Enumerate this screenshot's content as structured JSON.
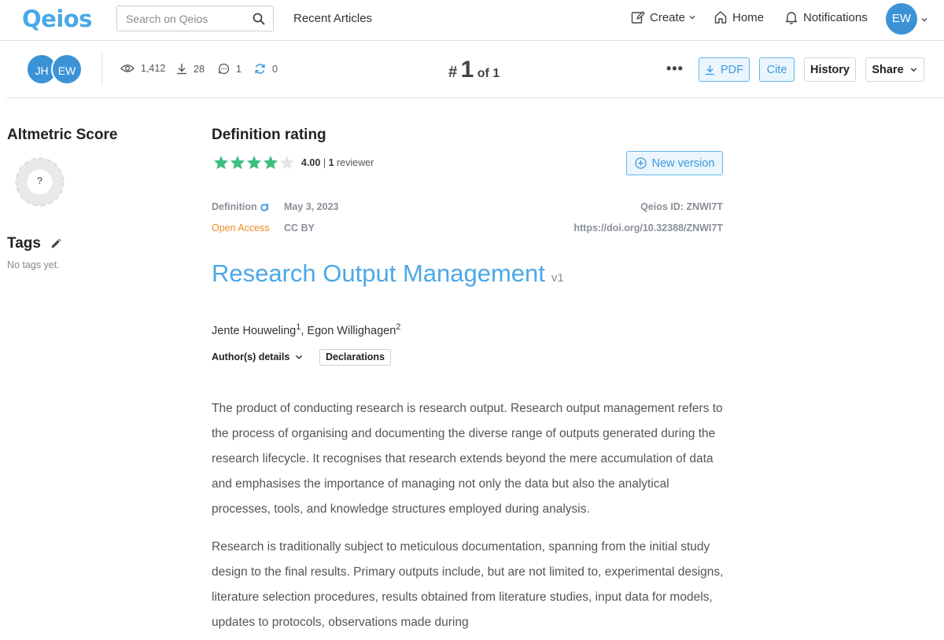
{
  "nav": {
    "logo": "Qeios",
    "search_placeholder": "Search on Qeios",
    "recent_articles": "Recent Articles",
    "create": "Create",
    "home": "Home",
    "notifications": "Notifications",
    "user_initials": "EW"
  },
  "toolbar": {
    "author_avatars": [
      "JH",
      "EW"
    ],
    "views": "1,412",
    "downloads": "28",
    "comments": "1",
    "versions": "0",
    "rank_hash": "#",
    "rank_num": "1",
    "rank_of": "of 1",
    "more": "•••",
    "pdf": "PDF",
    "cite": "Cite",
    "history": "History",
    "share": "Share"
  },
  "sidebar": {
    "altmetric_title": "Altmetric Score",
    "altmetric_value": "?",
    "tags_title": "Tags",
    "no_tags": "No tags yet."
  },
  "article": {
    "rating_title": "Definition rating",
    "rating_value": 4,
    "rating_max": 5,
    "rating_score": "4.00",
    "rating_sep": "|",
    "reviewer_count": "1",
    "reviewer_label": "reviewer",
    "new_version": "New version",
    "type": "Definition",
    "date": "May 3, 2023",
    "qeios_id": "Qeios ID: ZNWI7T",
    "open_access": "Open Access",
    "license": "CC BY",
    "doi": "https://doi.org/10.32388/ZNWI7T",
    "title": "Research Output Management",
    "version": "v1",
    "author1": "Jente Houweling",
    "author1_sup": "1",
    "author_sep": ", ",
    "author2": "Egon Willighagen",
    "author2_sup": "2",
    "author_details": "Author(s) details",
    "declarations": "Declarations",
    "paragraphs": [
      "The product of conducting research is research output. Research output management refers to the process of organising and documenting the diverse range of outputs generated during the research lifecycle. It recognises that research extends beyond the mere accumulation of data and emphasises the importance of managing not only the data but also the analytical processes, tools, and knowledge structures employed during analysis.",
      "Research is traditionally subject to meticulous documentation, spanning from the initial study design to the final results. Primary outputs include, but are not limited to, experimental designs, literature selection procedures, results obtained from literature studies, input data for models, updates to protocols, observations made during"
    ]
  },
  "colors": {
    "brand": "#4aa8e8",
    "avatar": "#3b93d6",
    "star": "#3fbf7f",
    "open_access": "#f08a24"
  }
}
